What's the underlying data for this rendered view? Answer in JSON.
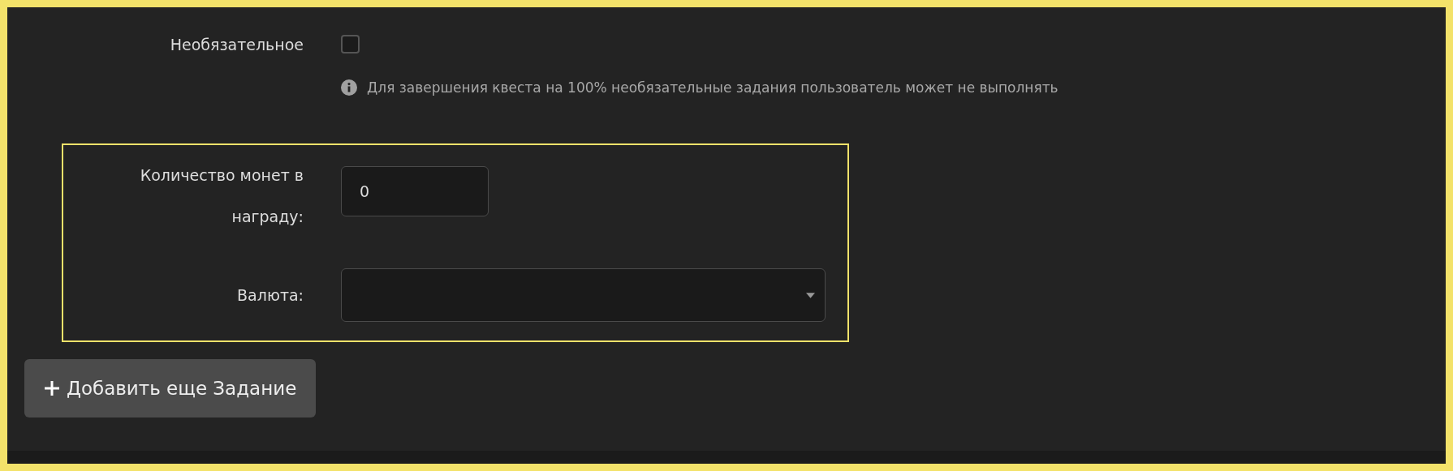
{
  "optional": {
    "label": "Необязательное",
    "checked": false,
    "hint": "Для завершения квеста на 100% необязательные задания пользователь может не выполнять"
  },
  "reward": {
    "highlighted": true,
    "coins": {
      "label": "Количество монет в награду:",
      "value": "0"
    },
    "currency": {
      "label": "Валюта:"
    }
  },
  "add_button": {
    "label": "Добавить еще Задание"
  }
}
